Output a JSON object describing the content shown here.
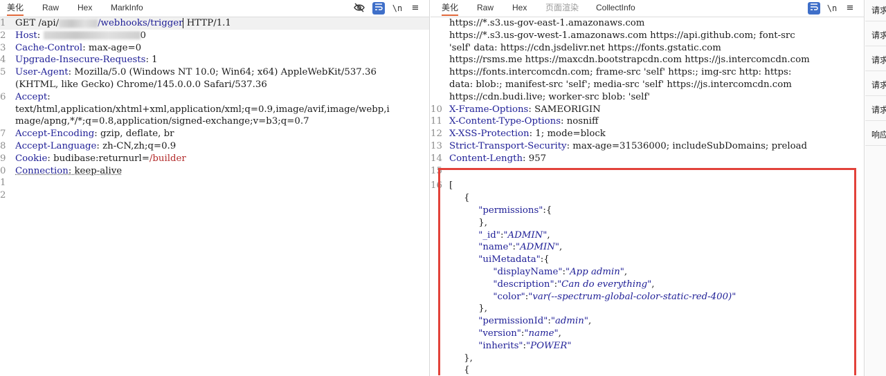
{
  "left": {
    "tabs": [
      "美化",
      "Raw",
      "Hex",
      "MarkInfo"
    ],
    "active_tab": 0,
    "tools": {
      "eye": "eye-slash-icon",
      "wrap": "wrap-icon",
      "newline": "\\n",
      "menu": "menu-icon"
    },
    "lines": [
      {
        "n": "1",
        "parts": [
          [
            "val",
            "GET /api/"
          ],
          [
            "blur",
            ""
          ],
          [
            "url",
            "/webhooks/trigger"
          ],
          [
            "caret",
            ""
          ],
          [
            "val",
            " HTTP/1.1"
          ]
        ],
        "hl": true
      },
      {
        "n": "2",
        "parts": [
          [
            "key",
            "Host"
          ],
          [
            "val",
            ": "
          ],
          [
            "blur",
            ""
          ],
          [
            "val",
            "0"
          ]
        ]
      },
      {
        "n": "3",
        "parts": [
          [
            "key",
            "Cache-Control"
          ],
          [
            "val",
            ": max-age=0"
          ]
        ]
      },
      {
        "n": "4",
        "parts": [
          [
            "key",
            "Upgrade-Insecure-Requests"
          ],
          [
            "val",
            ": 1"
          ]
        ]
      },
      {
        "n": "5",
        "parts": [
          [
            "key",
            "User-Agent"
          ],
          [
            "val",
            ": Mozilla/5.0 (Windows NT 10.0; Win64; x64) AppleWebKit/537.36"
          ]
        ]
      },
      {
        "n": "",
        "parts": [
          [
            "val",
            "(KHTML, like Gecko) Chrome/145.0.0.0 Safari/537.36"
          ]
        ]
      },
      {
        "n": "6",
        "parts": [
          [
            "key",
            "Accept"
          ],
          [
            "val",
            ":"
          ]
        ]
      },
      {
        "n": "",
        "parts": [
          [
            "val",
            "text/html,application/xhtml+xml,application/xml;q=0.9,image/avif,image/webp,i"
          ]
        ]
      },
      {
        "n": "",
        "parts": [
          [
            "val",
            "mage/apng,*/*;q=0.8,application/signed-exchange;v=b3;q=0.7"
          ]
        ]
      },
      {
        "n": "7",
        "parts": [
          [
            "key",
            "Accept-Encoding"
          ],
          [
            "val",
            ": gzip, deflate, br"
          ]
        ]
      },
      {
        "n": "8",
        "parts": [
          [
            "key",
            "Accept-Language"
          ],
          [
            "val",
            ": zh-CN,zh;q=0.9"
          ]
        ]
      },
      {
        "n": "9",
        "parts": [
          [
            "key",
            "Cookie"
          ],
          [
            "val",
            ": budibase:returnurl="
          ],
          [
            "red",
            "/builder"
          ]
        ]
      },
      {
        "n": "0",
        "parts": [
          [
            "key",
            "Connection"
          ],
          [
            "val",
            ": keep-alive"
          ]
        ],
        "underline": true
      },
      {
        "n": "1",
        "parts": []
      },
      {
        "n": "2",
        "parts": []
      }
    ]
  },
  "right": {
    "tabs": [
      "美化",
      "Raw",
      "Hex",
      "页面渲染",
      "CollectInfo"
    ],
    "active_tab": 0,
    "tools": {
      "wrap": "wrap-icon",
      "newline": "\\n",
      "menu": "menu-icon"
    },
    "lines": [
      {
        "n": "",
        "parts": [
          [
            "val",
            "https://*.s3.us-gov-east-1.amazonaws.com"
          ]
        ]
      },
      {
        "n": "",
        "parts": [
          [
            "val",
            "https://*.s3.us-gov-west-1.amazonaws.com https://api.github.com; font-src"
          ]
        ]
      },
      {
        "n": "",
        "parts": [
          [
            "val",
            "'self' data: https://cdn.jsdelivr.net https://fonts.gstatic.com"
          ]
        ]
      },
      {
        "n": "",
        "parts": [
          [
            "val",
            "https://rsms.me https://maxcdn.bootstrapcdn.com https://js.intercomcdn.com"
          ]
        ]
      },
      {
        "n": "",
        "parts": [
          [
            "val",
            "https://fonts.intercomcdn.com; frame-src 'self' https:; img-src http: https:"
          ]
        ]
      },
      {
        "n": "",
        "parts": [
          [
            "val",
            "data: blob:; manifest-src 'self'; media-src 'self' https://js.intercomcdn.com"
          ]
        ]
      },
      {
        "n": "",
        "parts": [
          [
            "val",
            "https://cdn.budi.live; worker-src blob: 'self'"
          ]
        ]
      },
      {
        "n": "10",
        "parts": [
          [
            "key",
            "X-Frame-Options"
          ],
          [
            "val",
            ": SAMEORIGIN"
          ]
        ]
      },
      {
        "n": "11",
        "parts": [
          [
            "key",
            "X-Content-Type-Options"
          ],
          [
            "val",
            ": nosniff"
          ]
        ]
      },
      {
        "n": "12",
        "parts": [
          [
            "key",
            "X-XSS-Protection"
          ],
          [
            "val",
            ": 1; mode=block"
          ]
        ]
      },
      {
        "n": "13",
        "parts": [
          [
            "key",
            "Strict-Transport-Security"
          ],
          [
            "val",
            ": max-age=31536000; includeSubDomains; preload"
          ]
        ]
      },
      {
        "n": "14",
        "parts": [
          [
            "key",
            "Content-Length"
          ],
          [
            "val",
            ": 957"
          ]
        ]
      },
      {
        "n": "15",
        "parts": []
      },
      {
        "n": "16",
        "parts": [
          [
            "val",
            "["
          ]
        ],
        "gap": true
      },
      {
        "n": "",
        "parts": [
          [
            "val",
            "     {"
          ]
        ]
      },
      {
        "n": "",
        "parts": [
          [
            "val",
            "          "
          ],
          [
            "jkey",
            "\"permissions\""
          ],
          [
            "val",
            ":{"
          ]
        ]
      },
      {
        "n": "",
        "parts": [
          [
            "val",
            "          },"
          ]
        ]
      },
      {
        "n": "",
        "parts": [
          [
            "val",
            "          "
          ],
          [
            "jkey",
            "\"_id\""
          ],
          [
            "val",
            ":"
          ],
          [
            "jstr",
            "\"ADMIN\""
          ],
          [
            "val",
            ","
          ]
        ]
      },
      {
        "n": "",
        "parts": [
          [
            "val",
            "          "
          ],
          [
            "jkey",
            "\"name\""
          ],
          [
            "val",
            ":"
          ],
          [
            "jstr",
            "\"ADMIN\""
          ],
          [
            "val",
            ","
          ]
        ]
      },
      {
        "n": "",
        "parts": [
          [
            "val",
            "          "
          ],
          [
            "jkey",
            "\"uiMetadata\""
          ],
          [
            "val",
            ":{"
          ]
        ]
      },
      {
        "n": "",
        "parts": [
          [
            "val",
            "               "
          ],
          [
            "jkey",
            "\"displayName\""
          ],
          [
            "val",
            ":"
          ],
          [
            "jstr",
            "\"App admin\""
          ],
          [
            "val",
            ","
          ]
        ]
      },
      {
        "n": "",
        "parts": [
          [
            "val",
            "               "
          ],
          [
            "jkey",
            "\"description\""
          ],
          [
            "val",
            ":"
          ],
          [
            "jstr",
            "\"Can do everything\""
          ],
          [
            "val",
            ","
          ]
        ]
      },
      {
        "n": "",
        "parts": [
          [
            "val",
            "               "
          ],
          [
            "jkey",
            "\"color\""
          ],
          [
            "val",
            ":"
          ],
          [
            "jstr",
            "\"var(--spectrum-global-color-static-red-400)\""
          ]
        ]
      },
      {
        "n": "",
        "parts": [
          [
            "val",
            "          },"
          ]
        ]
      },
      {
        "n": "",
        "parts": [
          [
            "val",
            "          "
          ],
          [
            "jkey",
            "\"permissionId\""
          ],
          [
            "val",
            ":"
          ],
          [
            "jstr",
            "\"admin\""
          ],
          [
            "val",
            ","
          ]
        ]
      },
      {
        "n": "",
        "parts": [
          [
            "val",
            "          "
          ],
          [
            "jkey",
            "\"version\""
          ],
          [
            "val",
            ":"
          ],
          [
            "jstr",
            "\"name\""
          ],
          [
            "val",
            ","
          ]
        ]
      },
      {
        "n": "",
        "parts": [
          [
            "val",
            "          "
          ],
          [
            "jkey",
            "\"inherits\""
          ],
          [
            "val",
            ":"
          ],
          [
            "jstr",
            "\"POWER\""
          ]
        ]
      },
      {
        "n": "",
        "parts": [
          [
            "val",
            "     },"
          ]
        ]
      },
      {
        "n": "",
        "parts": [
          [
            "val",
            "     {"
          ]
        ]
      }
    ]
  },
  "sidebar": {
    "items": [
      "请求",
      "请求",
      "请求",
      "请求",
      "请求",
      "响应"
    ]
  }
}
